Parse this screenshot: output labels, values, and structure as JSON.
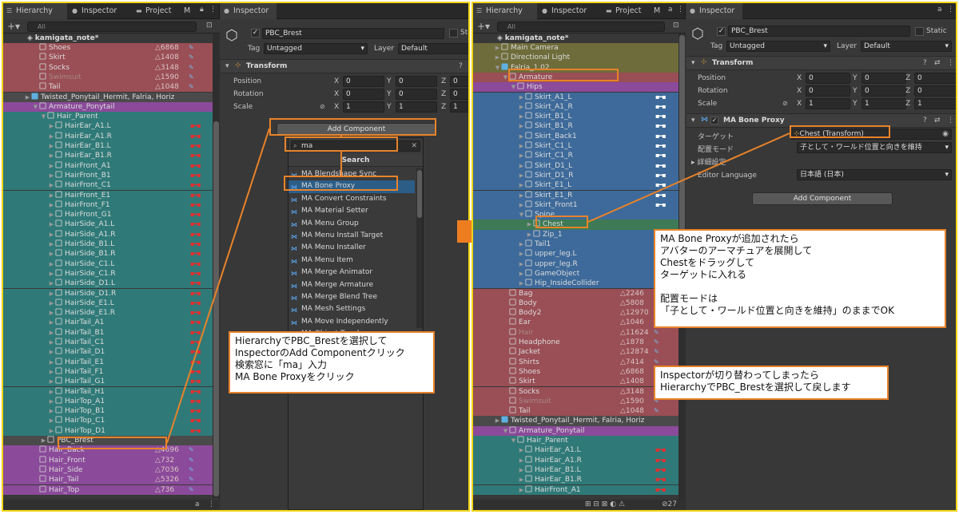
{
  "left": {
    "hierarchy_tab": "Hierarchy",
    "inspector_tab": "Inspector",
    "project_tab": "Project",
    "more_tab": "M",
    "search_placeholder": "All",
    "scene": "kamigata_note*",
    "rows": [
      {
        "name": "Shoes",
        "count": "6868",
        "depth": 4,
        "bg": "red"
      },
      {
        "name": "Skirt",
        "count": "1408",
        "depth": 4,
        "bg": "red"
      },
      {
        "name": "Socks",
        "count": "3148",
        "depth": 4,
        "bg": "red"
      },
      {
        "name": "Swimsuit",
        "count": "1590",
        "depth": 4,
        "bg": "red",
        "dim": true
      },
      {
        "name": "Tail",
        "count": "1048",
        "depth": 4,
        "bg": "red"
      },
      {
        "name": "Twisted_Ponytail_Hermit, Falria, Horiz",
        "depth": 3,
        "bg": "sel",
        "prefab": true
      },
      {
        "name": "Armature_Ponytail",
        "depth": 4,
        "bg": "purple",
        "expand": "open"
      },
      {
        "name": "Hair_Parent",
        "depth": 5,
        "bg": "teal",
        "expand": "open"
      },
      {
        "name": "HairEar_A1.L",
        "depth": 6,
        "bg": "teal",
        "bone": "red"
      },
      {
        "name": "HairEar_A1.R",
        "depth": 6,
        "bg": "teal",
        "bone": "red"
      },
      {
        "name": "HairEar_B1.L",
        "depth": 6,
        "bg": "teal",
        "bone": "red"
      },
      {
        "name": "HairEar_B1.R",
        "depth": 6,
        "bg": "teal",
        "bone": "red"
      },
      {
        "name": "HairFront_A1",
        "depth": 6,
        "bg": "teal",
        "bone": "red"
      },
      {
        "name": "HairFront_B1",
        "depth": 6,
        "bg": "teal",
        "bone": "red"
      },
      {
        "name": "HairFront_C1",
        "depth": 6,
        "bg": "teal",
        "bone": "red"
      },
      {
        "name": "HairFront_E1",
        "depth": 6,
        "bg": "teal",
        "bone": "red"
      },
      {
        "name": "HairFront_F1",
        "depth": 6,
        "bg": "teal",
        "bone": "red"
      },
      {
        "name": "HairFront_G1",
        "depth": 6,
        "bg": "teal",
        "bone": "red"
      },
      {
        "name": "HairSide_A1.L",
        "depth": 6,
        "bg": "teal",
        "bone": "red"
      },
      {
        "name": "HairSide_A1.R",
        "depth": 6,
        "bg": "teal",
        "bone": "red"
      },
      {
        "name": "HairSide_B1.L",
        "depth": 6,
        "bg": "teal",
        "bone": "red"
      },
      {
        "name": "HairSide_B1.R",
        "depth": 6,
        "bg": "teal",
        "bone": "red"
      },
      {
        "name": "HairSide_C1.L",
        "depth": 6,
        "bg": "teal",
        "bone": "red"
      },
      {
        "name": "HairSide_C1.R",
        "depth": 6,
        "bg": "teal",
        "bone": "red"
      },
      {
        "name": "HairSide_D1.L",
        "depth": 6,
        "bg": "teal",
        "bone": "red"
      },
      {
        "name": "HairSide_D1.R",
        "depth": 6,
        "bg": "teal",
        "bone": "red"
      },
      {
        "name": "HairSide_E1.L",
        "depth": 6,
        "bg": "teal",
        "bone": "red"
      },
      {
        "name": "HairSide_E1.R",
        "depth": 6,
        "bg": "teal",
        "bone": "red"
      },
      {
        "name": "HairTail_A1",
        "depth": 6,
        "bg": "teal",
        "bone": "red"
      },
      {
        "name": "HairTail_B1",
        "depth": 6,
        "bg": "teal",
        "bone": "red"
      },
      {
        "name": "HairTail_C1",
        "depth": 6,
        "bg": "teal",
        "bone": "red"
      },
      {
        "name": "HairTail_D1",
        "depth": 6,
        "bg": "teal",
        "bone": "red"
      },
      {
        "name": "HairTail_E1",
        "depth": 6,
        "bg": "teal",
        "bone": "red"
      },
      {
        "name": "HairTail_F1",
        "depth": 6,
        "bg": "teal",
        "bone": "red"
      },
      {
        "name": "HairTail_G1",
        "depth": 6,
        "bg": "teal",
        "bone": "red"
      },
      {
        "name": "HairTail_H1",
        "depth": 6,
        "bg": "teal",
        "bone": "red"
      },
      {
        "name": "HairTop_A1",
        "depth": 6,
        "bg": "teal",
        "bone": "red"
      },
      {
        "name": "HairTop_B1",
        "depth": 6,
        "bg": "teal",
        "bone": "red"
      },
      {
        "name": "HairTop_C1",
        "depth": 6,
        "bg": "teal",
        "bone": "red"
      },
      {
        "name": "HairTop_D1",
        "depth": 6,
        "bg": "teal",
        "bone": "red"
      },
      {
        "name": "PBC_Brest",
        "depth": 5,
        "bg": "sel"
      },
      {
        "name": "Hair_Back",
        "count": "4696",
        "depth": 4,
        "bg": "purple"
      },
      {
        "name": "Hair_Front",
        "count": "732",
        "depth": 4,
        "bg": "purple"
      },
      {
        "name": "Hair_Side",
        "count": "7036",
        "depth": 4,
        "bg": "purple"
      },
      {
        "name": "Hair_Tail",
        "count": "5326",
        "depth": 4,
        "bg": "purple"
      },
      {
        "name": "Hair_Top",
        "count": "736",
        "depth": 4,
        "bg": "purple"
      }
    ],
    "inspector": {
      "tab": "Inspector",
      "object_name": "PBC_Brest",
      "static_label": "Stat",
      "tag_label": "Tag",
      "tag_value": "Untagged",
      "layer_label": "Layer",
      "layer_value": "Default",
      "transform_title": "Transform",
      "position_label": "Position",
      "rotation_label": "Rotation",
      "scale_label": "Scale",
      "pos": [
        "0",
        "0",
        "0"
      ],
      "rot": [
        "0",
        "0",
        "0"
      ],
      "scl": [
        "1",
        "1",
        "1"
      ],
      "x": "X",
      "y": "Y",
      "z": "Z",
      "add_component": "Add Component",
      "search_value": "ma",
      "search_header": "Search",
      "dropdown_items": [
        "MA Blendshape Sync",
        "MA Bone Proxy",
        "MA Convert Constraints",
        "MA Material Setter",
        "MA Menu Group",
        "MA Menu Install Target",
        "MA Menu Installer",
        "MA Menu Item",
        "MA Merge Animator",
        "MA Merge Armature",
        "MA Merge Blend Tree",
        "MA Mesh Settings",
        "MA Move Independently",
        "MA Object Toggle"
      ]
    },
    "note": [
      "HierarchyでPBC_Brestを選択して",
      "InspectorのAdd Componentクリック",
      "検索窓に「ma」入力",
      "MA Bone Proxyをクリック"
    ]
  },
  "right": {
    "hierarchy_tab": "Hierarchy",
    "inspector_tab": "Inspector",
    "project_tab": "Project",
    "more_tab": "M",
    "search_placeholder": "All",
    "scene": "kamigata_note*",
    "rows": [
      {
        "name": "Main Camera",
        "depth": 3,
        "bg": "olive"
      },
      {
        "name": "Directional Light",
        "depth": 3,
        "bg": "olive"
      },
      {
        "name": "Falria_1.02",
        "depth": 3,
        "bg": "olive",
        "expand": "open",
        "prefab": true
      },
      {
        "name": "Armature",
        "depth": 4,
        "bg": "red",
        "expand": "open"
      },
      {
        "name": "Hips",
        "depth": 5,
        "bg": "purple",
        "expand": "open"
      },
      {
        "name": "Skirt_A1_L",
        "depth": 6,
        "bg": "blue",
        "bone": "white"
      },
      {
        "name": "Skirt_A1_R",
        "depth": 6,
        "bg": "blue",
        "bone": "white"
      },
      {
        "name": "Skirt_B1_L",
        "depth": 6,
        "bg": "blue",
        "bone": "white"
      },
      {
        "name": "Skirt_B1_R",
        "depth": 6,
        "bg": "blue",
        "bone": "white"
      },
      {
        "name": "Skirt_Back1",
        "depth": 6,
        "bg": "blue",
        "bone": "white"
      },
      {
        "name": "Skirt_C1_L",
        "depth": 6,
        "bg": "blue",
        "bone": "white"
      },
      {
        "name": "Skirt_C1_R",
        "depth": 6,
        "bg": "blue",
        "bone": "white"
      },
      {
        "name": "Skirt_D1_L",
        "depth": 6,
        "bg": "blue",
        "bone": "white"
      },
      {
        "name": "Skirt_D1_R",
        "depth": 6,
        "bg": "blue",
        "bone": "white"
      },
      {
        "name": "Skirt_E1_L",
        "depth": 6,
        "bg": "blue",
        "bone": "white"
      },
      {
        "name": "Skirt_E1_R",
        "depth": 6,
        "bg": "blue",
        "bone": "white"
      },
      {
        "name": "Skirt_Front1",
        "depth": 6,
        "bg": "blue",
        "bone": "white"
      },
      {
        "name": "Spine",
        "depth": 6,
        "bg": "blue",
        "expand": "open"
      },
      {
        "name": "Chest",
        "depth": 7,
        "bg": "green"
      },
      {
        "name": "Zip_1",
        "depth": 7,
        "bg": "blue"
      },
      {
        "name": "Tail1",
        "depth": 6,
        "bg": "blue"
      },
      {
        "name": "upper_leg.L",
        "depth": 6,
        "bg": "blue"
      },
      {
        "name": "upper_leg.R",
        "depth": 6,
        "bg": "blue"
      },
      {
        "name": "GameObject",
        "depth": 6,
        "bg": "blue"
      },
      {
        "name": "Hip_InsideCollider",
        "depth": 6,
        "bg": "blue"
      },
      {
        "name": "Bag",
        "count": "2246",
        "depth": 4,
        "bg": "red"
      },
      {
        "name": "Body",
        "count": "5808",
        "depth": 4,
        "bg": "red"
      },
      {
        "name": "Body2",
        "count": "12970",
        "depth": 4,
        "bg": "red"
      },
      {
        "name": "Ear",
        "count": "1046",
        "depth": 4,
        "bg": "red"
      },
      {
        "name": "Hair",
        "count": "11624",
        "depth": 4,
        "bg": "red",
        "dim": true
      },
      {
        "name": "Headphone",
        "count": "1878",
        "depth": 4,
        "bg": "red"
      },
      {
        "name": "Jacket",
        "count": "12874",
        "depth": 4,
        "bg": "red"
      },
      {
        "name": "Shirts",
        "count": "7414",
        "depth": 4,
        "bg": "red"
      },
      {
        "name": "Shoes",
        "count": "6868",
        "depth": 4,
        "bg": "red"
      },
      {
        "name": "Skirt",
        "count": "1408",
        "depth": 4,
        "bg": "red"
      },
      {
        "name": "Socks",
        "count": "3148",
        "depth": 4,
        "bg": "red"
      },
      {
        "name": "Swimsuit",
        "count": "1590",
        "depth": 4,
        "bg": "red",
        "dim": true
      },
      {
        "name": "Tail",
        "count": "1048",
        "depth": 4,
        "bg": "red"
      },
      {
        "name": "Twisted_Ponytail_Hermit, Falria, Horiz",
        "depth": 3,
        "bg": "sel",
        "prefab": true
      },
      {
        "name": "Armature_Ponytail",
        "depth": 4,
        "bg": "purple",
        "expand": "open"
      },
      {
        "name": "Hair_Parent",
        "depth": 5,
        "bg": "teal",
        "expand": "open"
      },
      {
        "name": "HairEar_A1.L",
        "depth": 6,
        "bg": "teal",
        "bone": "red"
      },
      {
        "name": "HairEar_A1.R",
        "depth": 6,
        "bg": "teal",
        "bone": "red"
      },
      {
        "name": "HairEar_B1.L",
        "depth": 6,
        "bg": "teal",
        "bone": "red"
      },
      {
        "name": "HairEar_B1.R",
        "depth": 6,
        "bg": "teal",
        "bone": "red"
      },
      {
        "name": "HairFront_A1",
        "depth": 6,
        "bg": "teal",
        "bone": "red"
      }
    ],
    "inspector": {
      "tab": "Inspector",
      "object_name": "PBC_Brest",
      "static_label": "Static",
      "tag_label": "Tag",
      "tag_value": "Untagged",
      "layer_label": "Layer",
      "layer_value": "Default",
      "transform_title": "Transform",
      "position_label": "Position",
      "rotation_label": "Rotation",
      "scale_label": "Scale",
      "pos": [
        "0",
        "0",
        "0"
      ],
      "rot": [
        "0",
        "0",
        "0"
      ],
      "scl": [
        "1",
        "1",
        "1"
      ],
      "x": "X",
      "y": "Y",
      "z": "Z",
      "bone_proxy_title": "MA Bone Proxy",
      "target_label": "ターゲット",
      "target_value": "Chest (Transform)",
      "mode_label": "配置モード",
      "mode_value": "子として・ワールド位置と向きを維持",
      "detail_label": "詳細設定",
      "editor_language_label": "Editor Language",
      "editor_language_value": "日本語 (日本)",
      "add_component": "Add Component"
    },
    "footer_count": "27",
    "note1": [
      "MA Bone Proxyが追加されたら",
      "アバターのアーマチュアを展開して",
      "Chestをドラッグして",
      "ターゲットに入れる",
      "",
      "配置モードは",
      "「子として・ワールド位置と向きを維持」のままでOK"
    ],
    "note2": [
      "Inspectorが切り替わってしまったら",
      "HierarchyでPBC_Brestを選択して戻します"
    ]
  },
  "colors": {
    "panel_border": "#f2d414",
    "highlight_orange": "#e8832a",
    "arrow_orange": "#ee7d20",
    "selection_blue": "#2c5d87",
    "bone_red": "#e23030"
  }
}
